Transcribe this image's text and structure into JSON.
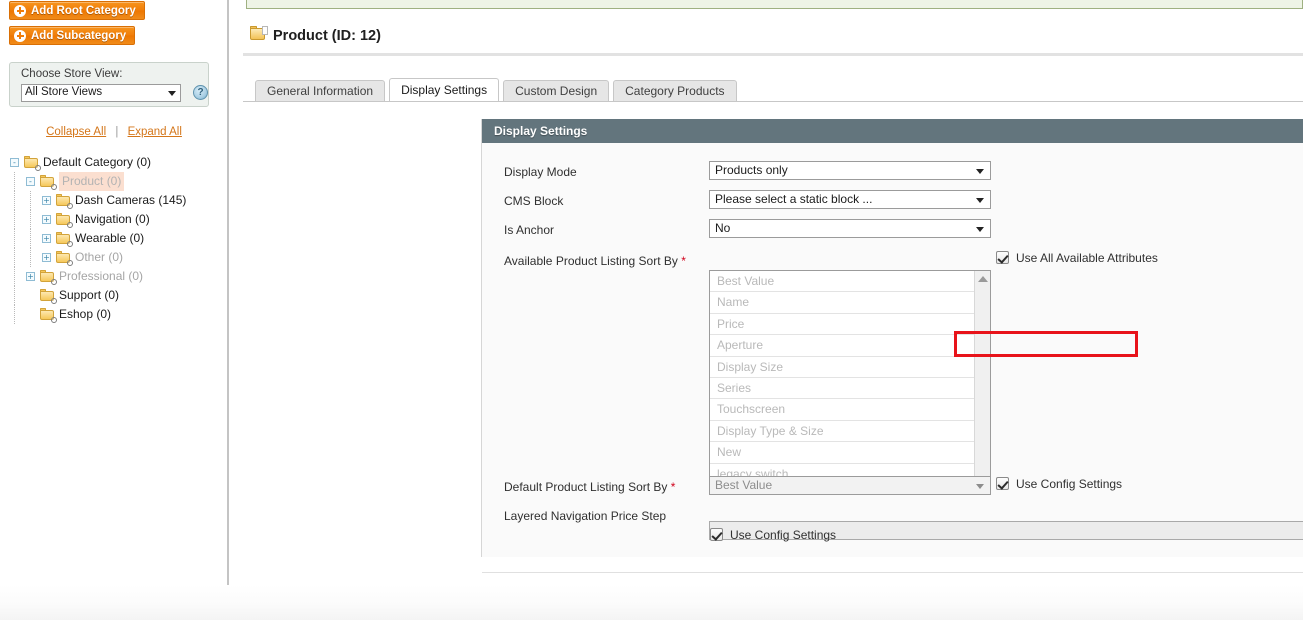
{
  "sidebar": {
    "buttons": [
      {
        "label": "Add Root Category",
        "icon": "plus-circle-icon"
      },
      {
        "label": "Add Subcategory",
        "icon": "plus-circle-icon"
      }
    ],
    "store_view": {
      "label": "Choose Store View:",
      "selected": "All Store Views",
      "help_icon": "question-mark-icon",
      "help_glyph": "?"
    },
    "tree_actions": {
      "collapse": "Collapse All",
      "separator": "|",
      "expand": "Expand All"
    },
    "tree": [
      {
        "label": "Default Category (0)",
        "depth": 0,
        "twist": "-",
        "state": "normal"
      },
      {
        "label": "Product (0)",
        "depth": 1,
        "twist": "-",
        "state": "active"
      },
      {
        "label": "Dash Cameras (145)",
        "depth": 2,
        "twist": "+",
        "state": "normal"
      },
      {
        "label": "Navigation (0)",
        "depth": 2,
        "twist": "+",
        "state": "normal"
      },
      {
        "label": "Wearable (0)",
        "depth": 2,
        "twist": "+",
        "state": "normal"
      },
      {
        "label": "Other (0)",
        "depth": 2,
        "twist": "+",
        "state": "dim"
      },
      {
        "label": "Professional (0)",
        "depth": 1,
        "twist": "+",
        "state": "dim"
      },
      {
        "label": "Support (0)",
        "depth": 1,
        "twist": "",
        "state": "normal"
      },
      {
        "label": "Eshop (0)",
        "depth": 1,
        "twist": "",
        "state": "normal"
      }
    ]
  },
  "main": {
    "page_title": "Product (ID: 12)",
    "title_icon": "category-folder-icon",
    "tabs": [
      {
        "label": "General Information",
        "selected": false
      },
      {
        "label": "Display Settings",
        "selected": true
      },
      {
        "label": "Custom Design",
        "selected": false
      },
      {
        "label": "Category Products",
        "selected": false
      }
    ],
    "panel": {
      "header": "Display Settings",
      "fields": {
        "display_mode": {
          "label": "Display Mode",
          "value": "Products only",
          "required": false
        },
        "cms_block": {
          "label": "CMS Block",
          "value": "Please select a static block ...",
          "required": false
        },
        "is_anchor": {
          "label": "Is Anchor",
          "value": "No",
          "required": false,
          "highlighted": true
        },
        "available_sort_by": {
          "label": "Available Product Listing Sort By",
          "required": true,
          "options": [
            "Best Value",
            "Name",
            "Price",
            "Aperture",
            "Display Size",
            "Series",
            "Touchscreen",
            "Display Type & Size",
            "New",
            "legacy switch"
          ],
          "checkbox": {
            "label": "Use All Available Attributes",
            "checked": true
          }
        },
        "default_sort_by": {
          "label": "Default Product Listing Sort By",
          "value": "Best Value",
          "required": true,
          "disabled": true,
          "checkbox": {
            "label": "Use Config Settings",
            "checked": true
          }
        },
        "price_step": {
          "label": "Layered Navigation Price Step",
          "value": "",
          "required": false,
          "disabled": true,
          "checkbox": {
            "label": "Use Config Settings",
            "checked": true
          }
        }
      }
    }
  },
  "colors": {
    "accent_orange": "#f07d09",
    "panel_header": "#63757d",
    "highlight_red": "#e8131a",
    "success_green_bg": "#eef4e6",
    "tree_active_bg": "#fbdfd0"
  }
}
